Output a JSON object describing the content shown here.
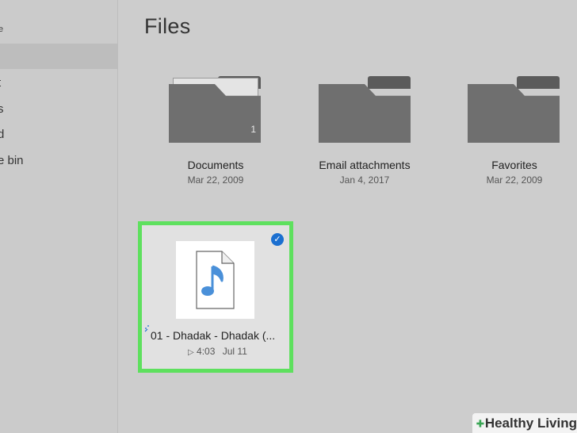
{
  "sidebar": {
    "header": "e",
    "items": [
      "t",
      "s",
      "d",
      "e bin"
    ]
  },
  "page_title": "Files",
  "folders": [
    {
      "name": "Documents",
      "date": "Mar 22, 2009",
      "count": "1"
    },
    {
      "name": "Email attachments",
      "date": "Jan 4, 2017"
    },
    {
      "name": "Favorites",
      "date": "Mar 22, 2009"
    }
  ],
  "file": {
    "name": "01 - Dhadak - Dhadak (...",
    "duration": "4:03",
    "date": "Jul 11",
    "selected": true,
    "icon": "music-file-icon"
  },
  "watermark": {
    "label": "Healthy Living"
  },
  "colors": {
    "selection_border": "#5ee05e",
    "check": "#1b6fd0",
    "music_note": "#4a90d9",
    "folder": "#6f6f6f"
  }
}
